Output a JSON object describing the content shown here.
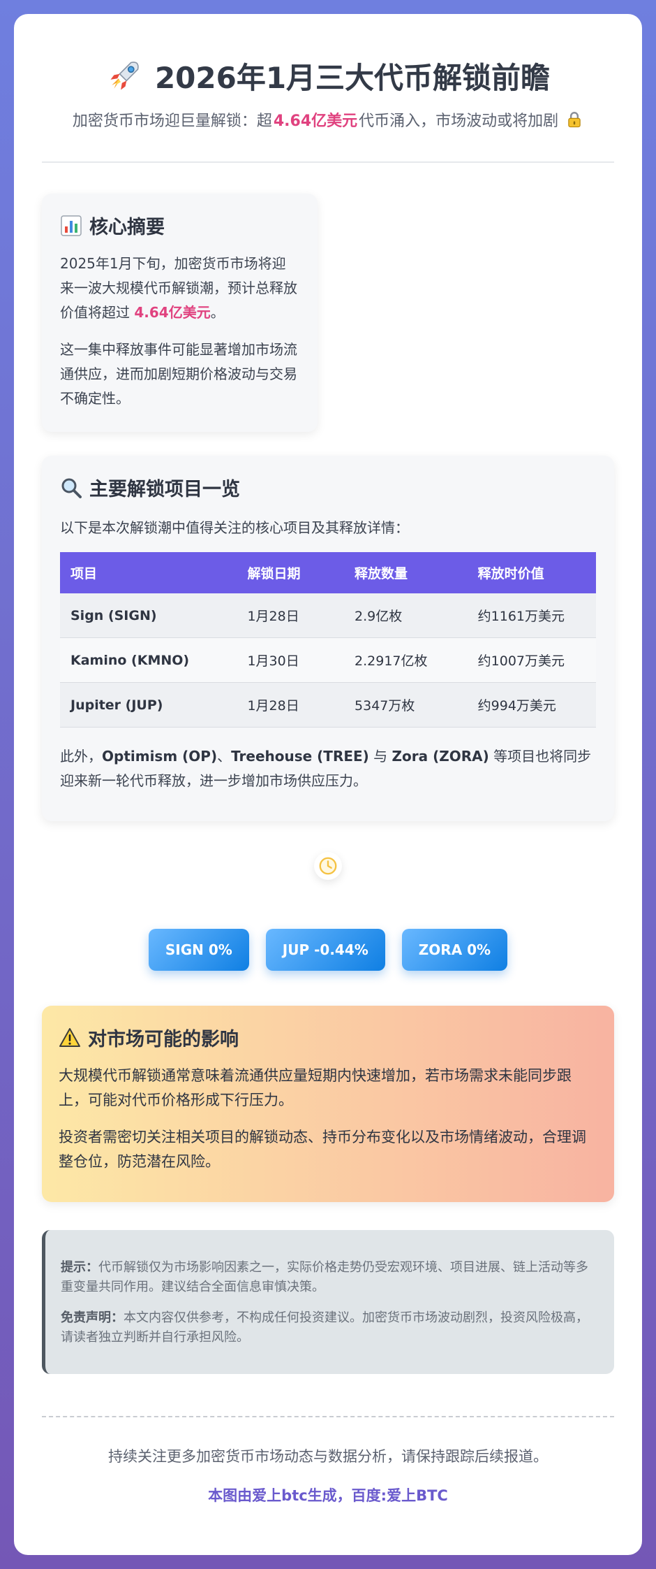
{
  "header": {
    "title": "2026年1月三大代币解锁前瞻",
    "subtitle_pre": "加密货币市场迎巨量解锁：超",
    "subtitle_highlight": "4.64亿美元",
    "subtitle_post": "代币涌入，市场波动或将加剧"
  },
  "summary": {
    "title": "核心摘要",
    "p1_pre": "2025年1月下旬，加密货币市场将迎来一波大规模代币解锁潮，预计总释放价值将超过 ",
    "p1_highlight": "4.64亿美元",
    "p1_post": "。",
    "p2": "这一集中释放事件可能显著增加市场流通供应，进而加剧短期价格波动与交易不确定性。"
  },
  "projects": {
    "title": "主要解锁项目一览",
    "intro": "以下是本次解锁潮中值得关注的核心项目及其释放详情：",
    "columns": [
      "项目",
      "解锁日期",
      "释放数量",
      "释放时价值"
    ],
    "rows": [
      [
        "Sign (SIGN)",
        "1月28日",
        "2.9亿枚",
        "约1161万美元"
      ],
      [
        "Kamino (KMNO)",
        "1月30日",
        "2.2917亿枚",
        "约1007万美元"
      ],
      [
        "Jupiter (JUP)",
        "1月28日",
        "5347万枚",
        "约994万美元"
      ]
    ],
    "note_pre": "此外，",
    "note_op": "Optimism (OP)",
    "note_sep1": "、",
    "note_tree": "Treehouse (TREE)",
    "note_sep2": " 与 ",
    "note_zora": "Zora (ZORA)",
    "note_post": " 等项目也将同步迎来新一轮代币释放，进一步增加市场供应压力。"
  },
  "tickers": [
    "SIGN 0%",
    "JUP -0.44%",
    "ZORA 0%"
  ],
  "impact": {
    "title": "对市场可能的影响",
    "p1": "大规模代币解锁通常意味着流通供应量短期内快速增加，若市场需求未能同步跟上，可能对代币价格形成下行压力。",
    "p2": "投资者需密切关注相关项目的解锁动态、持币分布变化以及市场情绪波动，合理调整仓位，防范潜在风险。"
  },
  "tips": {
    "tip_label": "提示：",
    "tip_text": "代币解锁仅为市场影响因素之一，实际价格走势仍受宏观环境、项目进展、链上活动等多重变量共同作用。建议结合全面信息审慎决策。",
    "disclaimer_label": "免责声明：",
    "disclaimer_text": "本文内容仅供参考，不构成任何投资建议。加密货币市场波动剧烈，投资风险极高，请读者独立判断并自行承担风险。"
  },
  "footer": {
    "line1": "持续关注更多加密货币市场动态与数据分析，请保持跟踪后续报道。",
    "line2": "本图由爱上btc生成，百度:爱上BTC"
  },
  "colors": {
    "accent": "#e0427f",
    "table_header": "#6c5ce7",
    "footer_brand": "#6a5acd",
    "ticker": "#1f8ef1"
  },
  "icons": {
    "title": "rocket-icon",
    "subtitle": "lock-icon",
    "summary": "bar-chart-icon",
    "projects": "magnifier-icon",
    "clock": "clock-icon",
    "impact": "warning-icon"
  }
}
